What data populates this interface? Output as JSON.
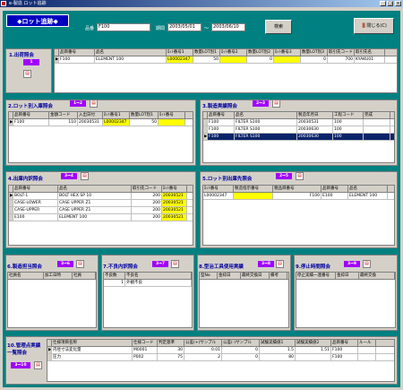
{
  "window": {
    "title": "e-製造 ロット追跡"
  },
  "header": {
    "logo": "◆ロット追跡◆",
    "hinban_label": "品番",
    "hinban_value": "F100",
    "kikan_label": "期間",
    "date_from": "2003/05/01",
    "tilde": "～",
    "date_to": "2003/06/10",
    "search": "検索",
    "close": "閉じる(C)"
  },
  "p1": {
    "title": "1.出荷照会",
    "badge": "1",
    "cols": [
      "品目番号",
      "品名",
      "ﾛｯﾄ番号1",
      "数量LOT別1",
      "ﾛｯﾄ番号2",
      "数量LOT別2",
      "ﾛｯﾄ番号3",
      "数量LOT別3",
      "取引先コード",
      "取引先名"
    ],
    "row": [
      "F100",
      "ELEMENT 100",
      "L00002347",
      "50",
      "",
      "0",
      "",
      "0",
      "700",
      "KYAKU01"
    ]
  },
  "p2": {
    "title": "2.ロット別入庫照会",
    "badge": "1⇒2",
    "cols": [
      "品目番号",
      "金額コード",
      "入出日付",
      "ﾛｯﾄ番号1",
      "数量LOT別1",
      "ﾛｯﾄ番号"
    ],
    "row": [
      "F100",
      "110",
      "20030531",
      "L00002347",
      "50",
      ""
    ]
  },
  "p3": {
    "title": "3.製造実績照会",
    "badge": "2⇒3",
    "cols": [
      "品目番号",
      "品名",
      "製造年月日",
      "工程コード",
      "完成"
    ],
    "rows": [
      [
        "F100",
        "FILTER S100",
        "20030531",
        "100",
        ""
      ],
      [
        "F100",
        "FILTER S100",
        "20030630",
        "100",
        ""
      ],
      [
        "F100",
        "FILTER S100",
        "20030630",
        "100",
        ""
      ]
    ]
  },
  "p4": {
    "title": "4.出庫内訳照会",
    "badge": "3⇒4",
    "cols": [
      "品目番号",
      "品名",
      "取引先コード",
      "ﾛｯﾄ番号"
    ],
    "rows": [
      [
        "BOLT-1",
        "BOLT HEX SP 10",
        "200",
        "20030521"
      ],
      [
        "CASE-LOWER",
        "CASE UPPER Z1",
        "200",
        "20030521"
      ],
      [
        "CASE-UPPER",
        "CASE UPPER Z1",
        "200",
        "20030521"
      ],
      [
        "E100",
        "ELEMENT 100",
        "200",
        "20030521"
      ]
    ]
  },
  "p5": {
    "title": "5.ロット別出庫先照会",
    "badge": "2⇒5",
    "cols": [
      "ﾛｯﾄ番号",
      "製造指示番号",
      "親品目番号",
      "品目番号",
      "品名"
    ],
    "row": [
      "L00002347",
      "",
      "F100",
      "E100",
      "ELEMENT 100"
    ]
  },
  "p6": {
    "title": "6.製造担当照会",
    "badge": "3⇒6",
    "cols": [
      "社員名",
      "加工日時",
      "社員"
    ]
  },
  "p7": {
    "title": "7.不良内訳照会",
    "badge": "3⇒7",
    "cols": [
      "不良数",
      "不良名"
    ],
    "row": [
      "1",
      "外観不良"
    ]
  },
  "p8": {
    "title": "8.型治工具使用実績",
    "badge": "3⇒8",
    "cols": [
      "型No",
      "金枠日",
      "最終交換日",
      "備考"
    ]
  },
  "p9": {
    "title": "9.停止時間照会",
    "badge": "3⇒9",
    "cols": [
      "停止実績一連番号",
      "金枠日",
      "最終交換"
    ]
  },
  "p10": {
    "title1": "10.管理点実績",
    "title2": "一覧照会",
    "badge": "3⇒10",
    "cols": [
      "仕様項目名称",
      "仕様コード",
      "判定基準",
      "公差(+)サンプル",
      "公差(-)サンプル",
      "試験実績値1",
      "試験実績値2",
      "品目番号",
      "ルール"
    ],
    "rows": [
      [
        "内径寸法変化量",
        "M0001",
        "30",
        "0.01",
        "0",
        "1.5",
        "1.51",
        "F100",
        ""
      ],
      [
        "圧力",
        "P002",
        "75",
        "2",
        "0",
        "80",
        "",
        "F100",
        ""
      ]
    ]
  }
}
